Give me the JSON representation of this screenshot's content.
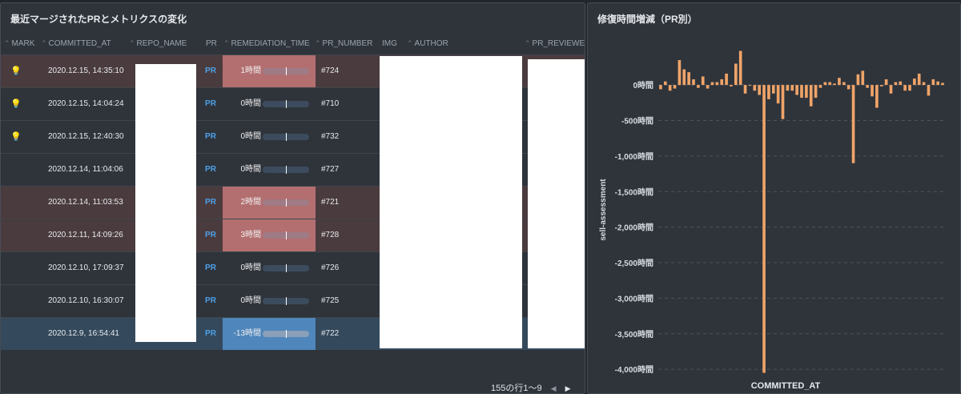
{
  "table_panel": {
    "title": "最近マージされたPRとメトリクスの変化",
    "columns": [
      "MARK",
      "COMMITTED_AT",
      "REPO_NAME",
      "PR",
      "REMEDIATION_TIME",
      "PR_NUMBER",
      "IMG",
      "AUTHOR",
      "PR_REVIEWER"
    ],
    "rows": [
      {
        "mark": "💡",
        "committed_at": "2020.12.15, 14:35:10",
        "pr": "PR",
        "remediation": "1時間",
        "pr_number": "#724",
        "highlight": "red",
        "rem_style": "red"
      },
      {
        "mark": "💡",
        "committed_at": "2020.12.15, 14:04:24",
        "pr": "PR",
        "remediation": "0時間",
        "pr_number": "#710",
        "highlight": "none",
        "rem_style": "none"
      },
      {
        "mark": "💡",
        "committed_at": "2020.12.15, 12:40:30",
        "pr": "PR",
        "remediation": "0時間",
        "pr_number": "#732",
        "highlight": "none",
        "rem_style": "none"
      },
      {
        "mark": "",
        "committed_at": "2020.12.14, 11:04:06",
        "pr": "PR",
        "remediation": "0時間",
        "pr_number": "#727",
        "highlight": "none",
        "rem_style": "none"
      },
      {
        "mark": "",
        "committed_at": "2020.12.14, 11:03:53",
        "pr": "PR",
        "remediation": "2時間",
        "pr_number": "#721",
        "highlight": "red",
        "rem_style": "red"
      },
      {
        "mark": "",
        "committed_at": "2020.12.11, 14:09:26",
        "pr": "PR",
        "remediation": "3時間",
        "pr_number": "#728",
        "highlight": "red",
        "rem_style": "red"
      },
      {
        "mark": "",
        "committed_at": "2020.12.10, 17:09:37",
        "pr": "PR",
        "remediation": "0時間",
        "pr_number": "#726",
        "highlight": "none",
        "rem_style": "none"
      },
      {
        "mark": "",
        "committed_at": "2020.12.10, 16:30:07",
        "pr": "PR",
        "remediation": "0時間",
        "pr_number": "#725",
        "highlight": "none",
        "rem_style": "none"
      },
      {
        "mark": "",
        "committed_at": "2020.12.9, 16:54:41",
        "pr": "PR",
        "remediation": "-13時間",
        "pr_number": "#722",
        "highlight": "blue",
        "rem_style": "blue"
      }
    ],
    "pagination": "155の行1〜9",
    "colors": {
      "highlight_red": "#4a3b3e",
      "highlight_blue": "#34495c",
      "rem_red": "#b36f70",
      "rem_blue": "#4f86bb",
      "link": "#4ea1e8"
    }
  },
  "chart_panel": {
    "title": "修復時間増減（PR別）"
  },
  "chart_data": {
    "type": "bar",
    "title": "修復時間増減（PR別）",
    "xlabel": "COMMITTED_AT",
    "ylabel": "sell-assessment",
    "ylim": [
      -4100,
      700
    ],
    "y_ticks": [
      {
        "value": 0,
        "label": "0時間"
      },
      {
        "value": -500,
        "label": "-500時間"
      },
      {
        "value": -1000,
        "label": "-1,000時間"
      },
      {
        "value": -1500,
        "label": "-1,500時間"
      },
      {
        "value": -2000,
        "label": "-2,000時間"
      },
      {
        "value": -2500,
        "label": "-2,500時間"
      },
      {
        "value": -3000,
        "label": "-3,000時間"
      },
      {
        "value": -3500,
        "label": "-3,500時間"
      },
      {
        "value": -4000,
        "label": "-4,000時間"
      }
    ],
    "grid": true,
    "bar_color": "#f0a469",
    "values": [
      -60,
      50,
      -80,
      -50,
      350,
      220,
      180,
      80,
      -40,
      120,
      -50,
      40,
      40,
      80,
      160,
      -20,
      300,
      480,
      -120,
      -10,
      -80,
      -140,
      -4050,
      -200,
      -120,
      -260,
      -480,
      -80,
      -80,
      -140,
      -180,
      -180,
      -300,
      -180,
      -40,
      40,
      40,
      20,
      100,
      40,
      -60,
      -1100,
      150,
      200,
      -40,
      -160,
      -320,
      -20,
      80,
      -120,
      40,
      50,
      -80,
      -80,
      90,
      160,
      40,
      -150,
      80,
      50,
      30
    ],
    "legend": "none"
  }
}
